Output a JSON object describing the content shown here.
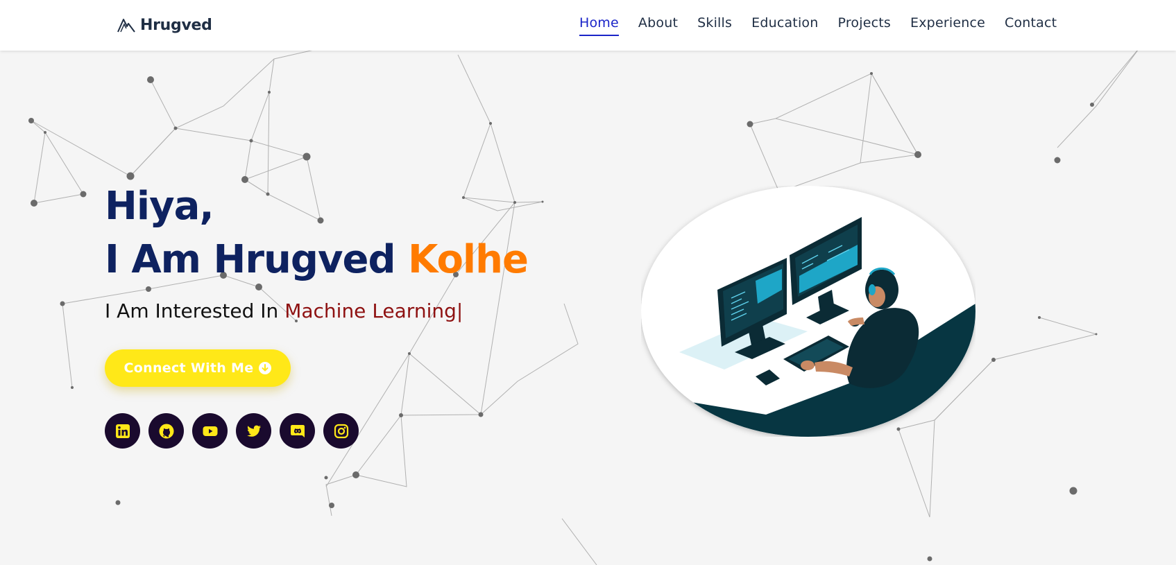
{
  "header": {
    "brand_name": "Hrugved",
    "brand_icon": "mountain-logo-icon",
    "nav": [
      {
        "label": "Home",
        "active": true
      },
      {
        "label": "About",
        "active": false
      },
      {
        "label": "Skills",
        "active": false
      },
      {
        "label": "Education",
        "active": false
      },
      {
        "label": "Projects",
        "active": false
      },
      {
        "label": "Experience",
        "active": false
      },
      {
        "label": "Contact",
        "active": false
      }
    ]
  },
  "hero": {
    "greeting": "Hiya,",
    "name_prefix": "I Am Hrugved ",
    "name_accent": "Kolhe",
    "interest_prefix": "I Am Interested In ",
    "interest_typed": "Machine Learning|",
    "cta_label": "Connect With Me",
    "cta_icon": "arrow-down-circle-icon"
  },
  "socials": [
    {
      "name": "linkedin",
      "icon": "linkedin-icon"
    },
    {
      "name": "github",
      "icon": "github-icon"
    },
    {
      "name": "youtube",
      "icon": "youtube-icon"
    },
    {
      "name": "twitter",
      "icon": "twitter-icon"
    },
    {
      "name": "discord",
      "icon": "discord-icon"
    },
    {
      "name": "instagram",
      "icon": "instagram-icon"
    }
  ],
  "colors": {
    "nav_active": "#1a24c8",
    "heading": "#0e2260",
    "accent_orange": "#ff7b00",
    "typed_red": "#8e1111",
    "cta_yellow": "#ffe818",
    "social_bg": "#1a0a2e",
    "social_fg": "#ffe818",
    "background": "#f5f5f5"
  }
}
